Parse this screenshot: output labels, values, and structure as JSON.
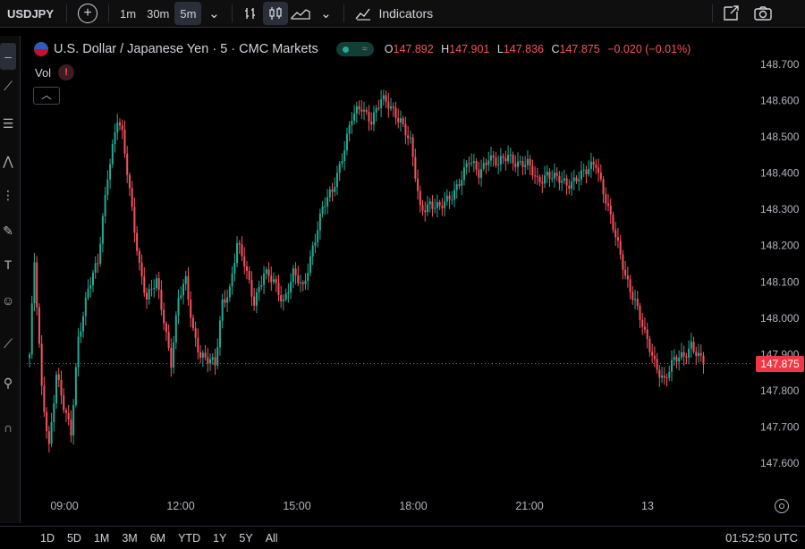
{
  "topbar": {
    "symbol": "USDJPY",
    "add_symbol": "+",
    "intervals": [
      "1m",
      "30m",
      "5m"
    ],
    "active_interval": "5m",
    "indicators_label": "Indicators"
  },
  "legend": {
    "title": "U.S. Dollar / Japanese Yen · 5 · CMC Markets",
    "ohlc": {
      "o_key": "O",
      "o_val": "147.892",
      "h_key": "H",
      "h_val": "147.901",
      "l_key": "L",
      "l_val": "147.836",
      "c_key": "C",
      "c_val": "147.875",
      "change": "−0.020 (−0.01%)"
    },
    "vol_label": "Vol",
    "vol_warning": "!"
  },
  "price_axis": {
    "labels": [
      "148.700",
      "148.600",
      "148.500",
      "148.400",
      "148.300",
      "148.200",
      "148.100",
      "148.000",
      "147.900",
      "147.800",
      "147.700",
      "147.600"
    ],
    "current_price": "147.875"
  },
  "time_axis": {
    "labels": [
      "09:00",
      "12:00",
      "15:00",
      "18:00",
      "21:00",
      "13"
    ]
  },
  "bottombar": {
    "ranges": [
      "1D",
      "5D",
      "1M",
      "3M",
      "6M",
      "YTD",
      "1Y",
      "5Y",
      "All"
    ],
    "clock": "01:52:50 UTC"
  },
  "colors": {
    "up": "#22ab94",
    "down": "#f7525f",
    "price_tag": "#f23645",
    "background": "#000000"
  },
  "chart_data": {
    "type": "candlestick",
    "ylim": [
      147.55,
      148.72
    ],
    "anchors": [
      [
        0,
        147.9
      ],
      [
        2,
        148.15
      ],
      [
        5,
        147.8
      ],
      [
        8,
        147.65
      ],
      [
        11,
        147.85
      ],
      [
        14,
        147.75
      ],
      [
        17,
        147.68
      ],
      [
        20,
        147.95
      ],
      [
        24,
        148.08
      ],
      [
        28,
        148.15
      ],
      [
        32,
        148.4
      ],
      [
        36,
        148.55
      ],
      [
        38,
        148.5
      ],
      [
        42,
        148.3
      ],
      [
        45,
        148.15
      ],
      [
        48,
        148.05
      ],
      [
        52,
        148.1
      ],
      [
        55,
        148.0
      ],
      [
        58,
        147.88
      ],
      [
        61,
        148.05
      ],
      [
        64,
        148.1
      ],
      [
        67,
        147.97
      ],
      [
        70,
        147.9
      ],
      [
        73,
        147.88
      ],
      [
        76,
        147.87
      ],
      [
        79,
        148.05
      ],
      [
        82,
        148.08
      ],
      [
        85,
        148.2
      ],
      [
        88,
        148.15
      ],
      [
        92,
        148.05
      ],
      [
        96,
        148.12
      ],
      [
        100,
        148.1
      ],
      [
        104,
        148.05
      ],
      [
        108,
        148.12
      ],
      [
        112,
        148.08
      ],
      [
        116,
        148.2
      ],
      [
        120,
        148.3
      ],
      [
        124,
        148.35
      ],
      [
        128,
        148.45
      ],
      [
        132,
        148.55
      ],
      [
        136,
        148.58
      ],
      [
        140,
        148.55
      ],
      [
        144,
        148.6
      ],
      [
        148,
        148.58
      ],
      [
        152,
        148.55
      ],
      [
        156,
        148.48
      ],
      [
        160,
        148.3
      ],
      [
        164,
        148.32
      ],
      [
        168,
        148.3
      ],
      [
        172,
        148.33
      ],
      [
        176,
        148.38
      ],
      [
        180,
        148.43
      ],
      [
        184,
        148.4
      ],
      [
        188,
        148.45
      ],
      [
        192,
        148.42
      ],
      [
        196,
        148.45
      ],
      [
        200,
        148.43
      ],
      [
        204,
        148.42
      ],
      [
        208,
        148.38
      ],
      [
        212,
        148.4
      ],
      [
        216,
        148.38
      ],
      [
        220,
        148.37
      ],
      [
        224,
        148.39
      ],
      [
        228,
        148.4
      ],
      [
        232,
        148.43
      ],
      [
        236,
        148.33
      ],
      [
        240,
        148.22
      ],
      [
        244,
        148.12
      ],
      [
        248,
        148.05
      ],
      [
        252,
        147.95
      ],
      [
        256,
        147.88
      ],
      [
        260,
        147.83
      ],
      [
        264,
        147.88
      ],
      [
        268,
        147.9
      ],
      [
        271,
        147.93
      ],
      [
        274,
        147.89
      ],
      [
        276,
        147.875
      ]
    ]
  }
}
